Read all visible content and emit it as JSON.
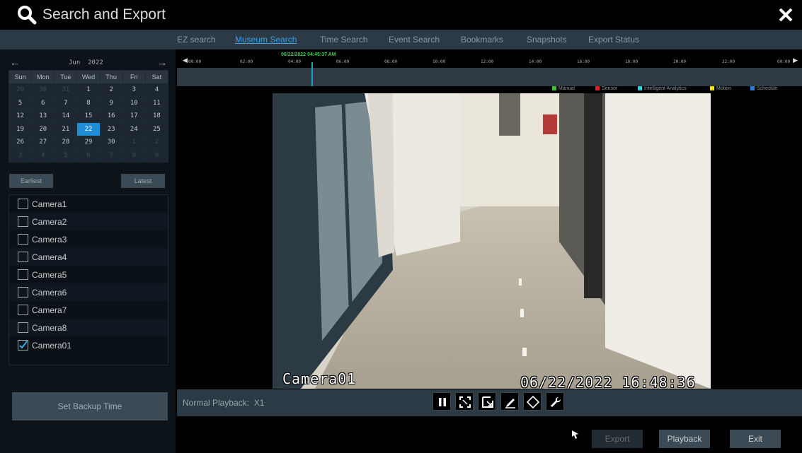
{
  "window": {
    "title": "Search and Export"
  },
  "tabs": [
    {
      "label": "EZ search",
      "active": false
    },
    {
      "label": "Museum Search",
      "active": true
    },
    {
      "label": "Time Search",
      "active": false
    },
    {
      "label": "Event Search",
      "active": false
    },
    {
      "label": "Bookmarks",
      "active": false
    },
    {
      "label": "Snapshots",
      "active": false
    },
    {
      "label": "Export Status",
      "active": false
    }
  ],
  "calendar": {
    "month": "Jun",
    "year": "2022",
    "weekdays": [
      "Sun",
      "Mon",
      "Tue",
      "Wed",
      "Thu",
      "Fri",
      "Sat"
    ],
    "weeks": [
      [
        "29",
        "30",
        "31",
        "1",
        "2",
        "3",
        "4"
      ],
      [
        "5",
        "6",
        "7",
        "8",
        "9",
        "10",
        "11"
      ],
      [
        "12",
        "13",
        "14",
        "15",
        "16",
        "17",
        "18"
      ],
      [
        "19",
        "20",
        "21",
        "22",
        "23",
        "24",
        "25"
      ],
      [
        "26",
        "27",
        "28",
        "29",
        "30",
        "1",
        "2"
      ],
      [
        "3",
        "4",
        "5",
        "6",
        "7",
        "8",
        "9"
      ]
    ],
    "selected_day": "22",
    "earliest_label": "Earliest",
    "latest_label": "Latest"
  },
  "cameras": [
    {
      "label": "Camera1",
      "checked": false
    },
    {
      "label": "Camera2",
      "checked": false
    },
    {
      "label": "Camera3",
      "checked": false
    },
    {
      "label": "Camera4",
      "checked": false
    },
    {
      "label": "Camera5",
      "checked": false
    },
    {
      "label": "Camera6",
      "checked": false
    },
    {
      "label": "Camera7",
      "checked": false
    },
    {
      "label": "Camera8",
      "checked": false
    },
    {
      "label": "Camera01",
      "checked": true
    }
  ],
  "backup_button": "Set Backup Time",
  "timeline": {
    "cursor_label": "06/22/2022 04:45:37 AM",
    "hours": [
      "00:00",
      "02:00",
      "04:00",
      "06:00",
      "08:00",
      "10:00",
      "12:00",
      "14:00",
      "16:00",
      "18:00",
      "20:00",
      "22:00",
      "00:00"
    ],
    "legend": [
      {
        "label": "Manual",
        "color": "#35c23c"
      },
      {
        "label": "Sensor",
        "color": "#e02020"
      },
      {
        "label": "Intelligent Analytics",
        "color": "#2ad0e0"
      },
      {
        "label": "Motion",
        "color": "#f2e200"
      },
      {
        "label": "Schedule",
        "color": "#2b7be0"
      }
    ]
  },
  "video": {
    "osd_camera": "Camera01",
    "osd_timestamp": "06/22/2022 16:48:36"
  },
  "playback": {
    "mode_label": "Normal Playback:",
    "speed": "X1",
    "controls": [
      "pause-icon",
      "fit-screen-icon",
      "expand-icon",
      "edit-icon",
      "ptz-icon",
      "wrench-icon"
    ]
  },
  "footer": {
    "export_label": "Export",
    "playback_label": "Playback",
    "exit_label": "Exit"
  }
}
